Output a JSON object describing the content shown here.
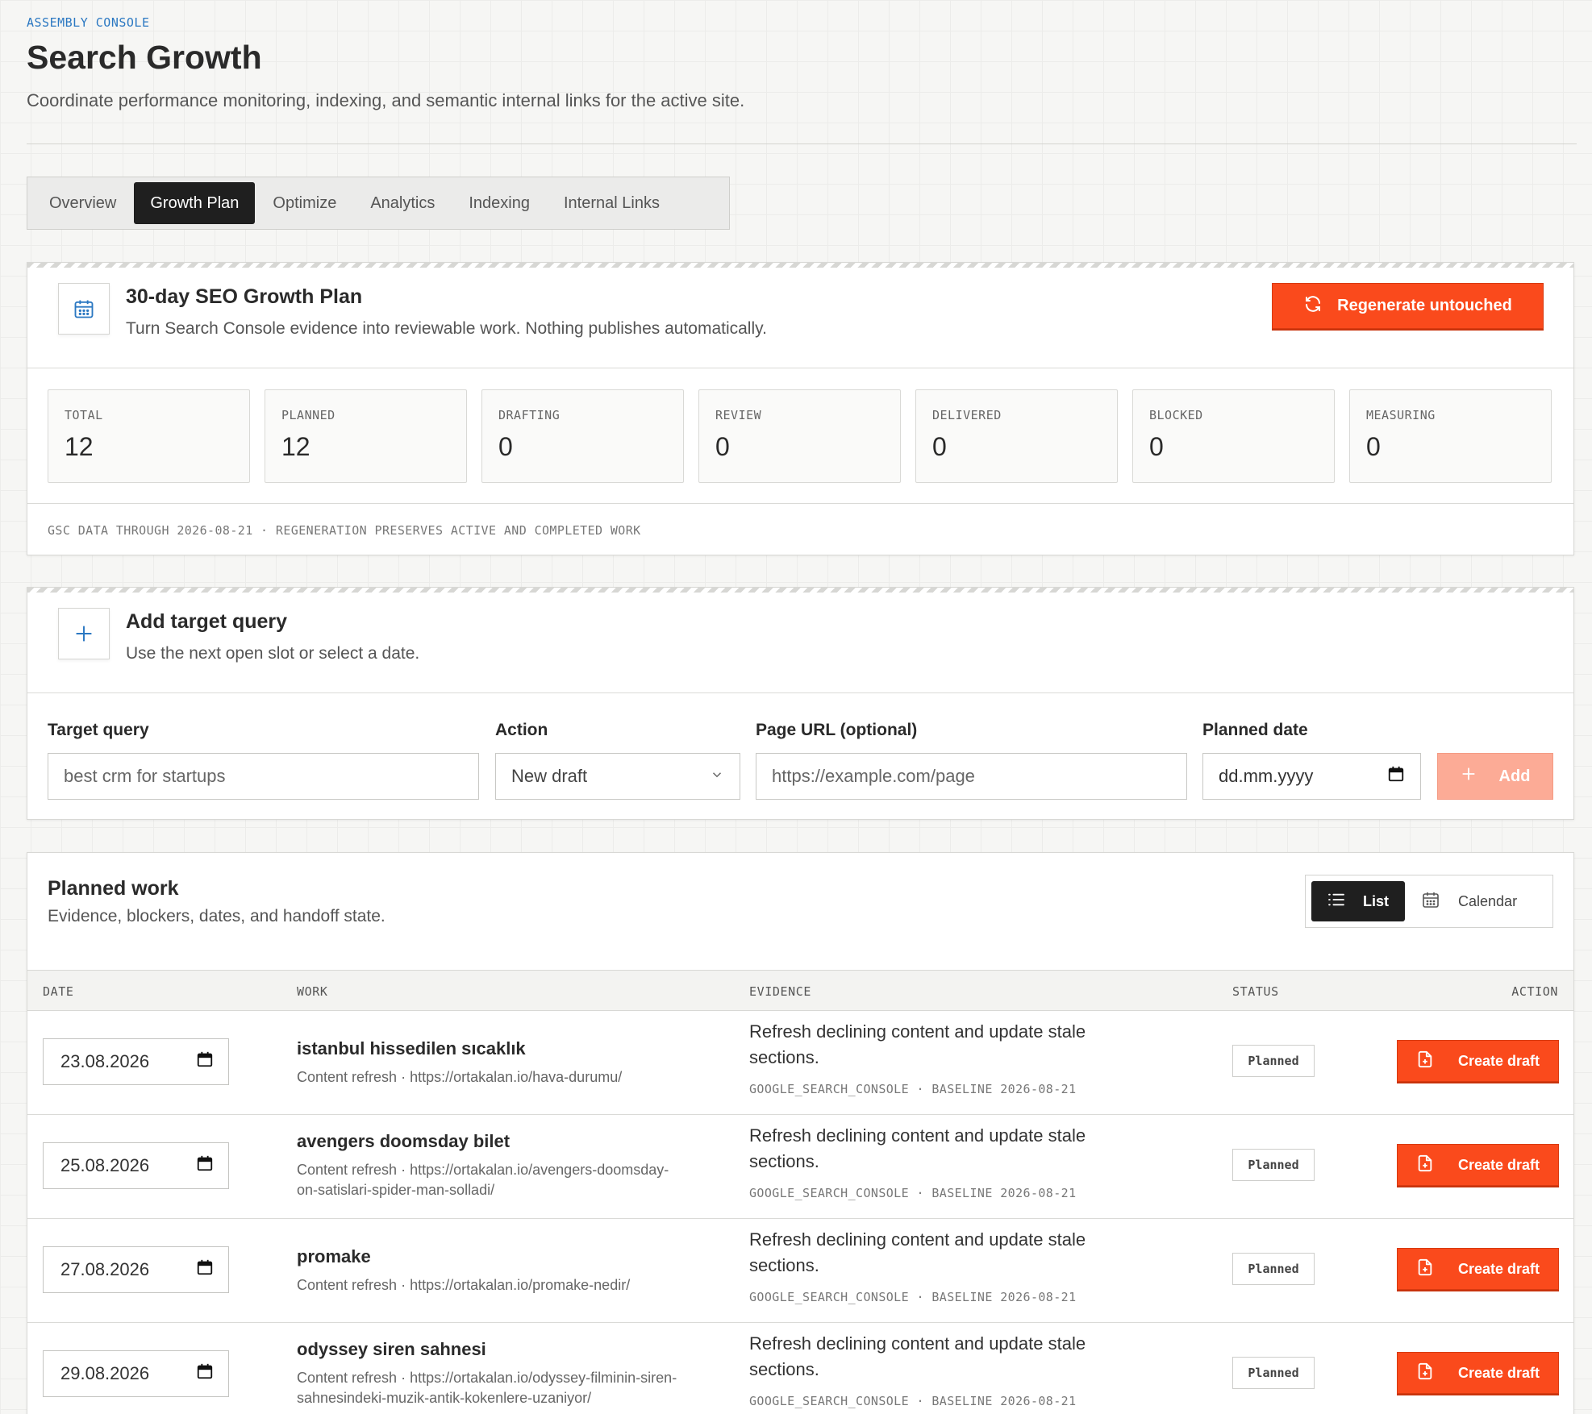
{
  "header": {
    "kicker": "ASSEMBLY CONSOLE",
    "title": "Search Growth",
    "subtitle": "Coordinate performance monitoring, indexing, and semantic internal links for the active site."
  },
  "tabs": [
    {
      "label": "Overview"
    },
    {
      "label": "Growth Plan"
    },
    {
      "label": "Optimize"
    },
    {
      "label": "Analytics"
    },
    {
      "label": "Indexing"
    },
    {
      "label": "Internal Links"
    }
  ],
  "active_tab": "Growth Plan",
  "plan": {
    "icon": "calendar-icon",
    "title": "30-day SEO Growth Plan",
    "subtitle": "Turn Search Console evidence into reviewable work. Nothing publishes automatically.",
    "regenerate_label": "Regenerate untouched",
    "regenerate_icon": "refresh-icon",
    "stats": [
      {
        "label": "TOTAL",
        "value": "12"
      },
      {
        "label": "PLANNED",
        "value": "12"
      },
      {
        "label": "DRAFTING",
        "value": "0"
      },
      {
        "label": "REVIEW",
        "value": "0"
      },
      {
        "label": "DELIVERED",
        "value": "0"
      },
      {
        "label": "BLOCKED",
        "value": "0"
      },
      {
        "label": "MEASURING",
        "value": "0"
      }
    ],
    "footnote": "GSC DATA THROUGH 2026-08-21 · REGENERATION PRESERVES ACTIVE AND COMPLETED WORK"
  },
  "add_query": {
    "icon": "plus-icon",
    "title": "Add target query",
    "subtitle": "Use the next open slot or select a date.",
    "fields": {
      "target_query": {
        "label": "Target query",
        "placeholder": "best crm for startups"
      },
      "action": {
        "label": "Action",
        "value": "New draft"
      },
      "page_url": {
        "label": "Page URL (optional)",
        "placeholder": "https://example.com/page"
      },
      "planned_date": {
        "label": "Planned date",
        "placeholder": "dd.mm.yyyy"
      }
    },
    "add_label": "Add"
  },
  "planned_work": {
    "title": "Planned work",
    "subtitle": "Evidence, blockers, dates, and handoff state.",
    "view_list_label": "List",
    "view_calendar_label": "Calendar",
    "columns": {
      "date": "DATE",
      "work": "WORK",
      "evidence": "EVIDENCE",
      "status": "STATUS",
      "action": "ACTION"
    },
    "rows": [
      {
        "date": "23.08.2026",
        "title": "istanbul hissedilen sıcaklık",
        "meta": "Content refresh · https://ortakalan.io/hava-durumu/",
        "evidence": "Refresh declining content and update stale sections.",
        "evidence_meta": "GOOGLE_SEARCH_CONSOLE · BASELINE 2026-08-21",
        "status": "Planned",
        "action": "Create draft"
      },
      {
        "date": "25.08.2026",
        "title": "avengers doomsday bilet",
        "meta": "Content refresh · https://ortakalan.io/avengers-doomsday-on-satislari-spider-man-solladi/",
        "evidence": "Refresh declining content and update stale sections.",
        "evidence_meta": "GOOGLE_SEARCH_CONSOLE · BASELINE 2026-08-21",
        "status": "Planned",
        "action": "Create draft"
      },
      {
        "date": "27.08.2026",
        "title": "promake",
        "meta": "Content refresh · https://ortakalan.io/promake-nedir/",
        "evidence": "Refresh declining content and update stale sections.",
        "evidence_meta": "GOOGLE_SEARCH_CONSOLE · BASELINE 2026-08-21",
        "status": "Planned",
        "action": "Create draft"
      },
      {
        "date": "29.08.2026",
        "title": "odyssey siren sahnesi",
        "meta": "Content refresh · https://ortakalan.io/odyssey-filminin-siren-sahnesindeki-muzik-antik-kokenlere-uzaniyor/",
        "evidence": "Refresh declining content and update stale sections.",
        "evidence_meta": "GOOGLE_SEARCH_CONSOLE · BASELINE 2026-08-21",
        "status": "Planned",
        "action": "Create draft"
      }
    ]
  },
  "colors": {
    "accent": "#fa4a1c",
    "link_blue": "#2b78c2",
    "dark": "#1f1f1f"
  }
}
